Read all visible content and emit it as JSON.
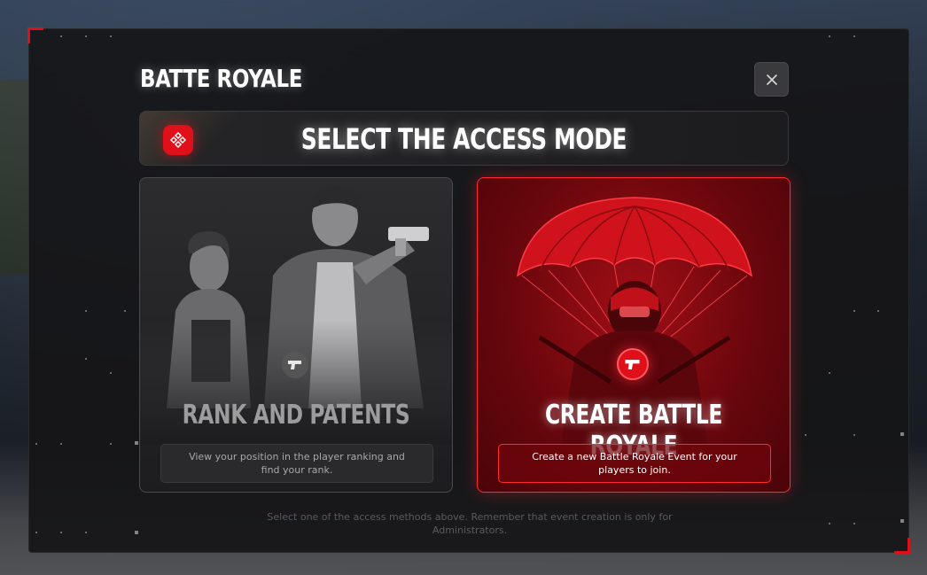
{
  "window": {
    "title": "BATTE ROYALE",
    "close_label": "×"
  },
  "mode_bar": {
    "title": "SELECT THE ACCESS MODE",
    "icon": "gamepad-icon"
  },
  "cards": [
    {
      "id": "rank",
      "label": "RANK AND PATENTS",
      "description": "View your position in the player ranking and find your rank.",
      "icon": "pistol-icon",
      "selected": false
    },
    {
      "id": "create",
      "label": "CREATE BATTLE ROYALE",
      "description": "Create a new Battle Royale Event for your players to join.",
      "icon": "pistol-icon",
      "selected": true
    }
  ],
  "footer": {
    "note": "Select one of the access methods above. Remember that event creation is only for Administrators."
  },
  "colors": {
    "accent": "#e0101a",
    "modal_bg": "#161618",
    "text_primary": "#ffffff",
    "text_muted": "#5a5a5d"
  }
}
